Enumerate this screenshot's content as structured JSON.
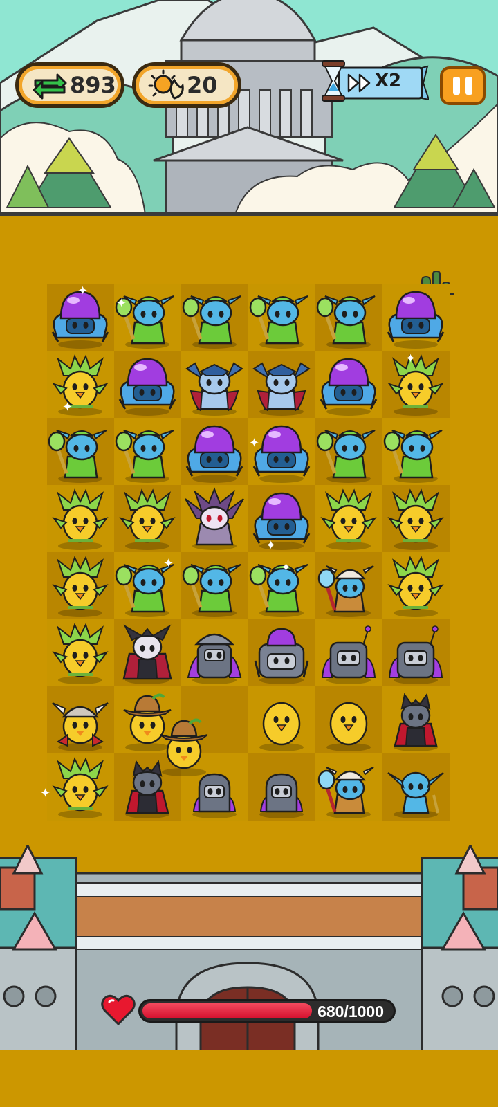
{
  "hud": {
    "swaps_value": "893",
    "swaps_icon": "swap-arrows-icon",
    "energy_value": "20",
    "energy_icon": "sun-moon-icon",
    "speed_label": "X2",
    "speed_icon": "fast-forward-icon",
    "timer_icon": "hourglass-icon",
    "pause_icon": "pause-icon"
  },
  "health": {
    "text": "680/1000",
    "fraction": 0.68,
    "icon": "heart-icon"
  },
  "board": {
    "columns": 6,
    "rows": 8,
    "grid": [
      [
        "purple-dome-crab",
        "green-goblin-mace",
        "green-goblin-mace",
        "green-goblin-mace",
        "green-goblin-mace",
        "purple-dome-crab"
      ],
      [
        "leaf-chick",
        "purple-dome-crab",
        "blue-winged-demon",
        "blue-winged-demon",
        "purple-dome-crab",
        "leaf-chick"
      ],
      [
        "green-goblin-mace",
        "green-goblin-mace",
        "purple-dome-crab",
        "purple-dome-crab",
        "green-goblin-mace",
        "green-goblin-mace"
      ],
      [
        "leaf-chick",
        "leaf-chick",
        "purple-demon-lord",
        "purple-dome-crab",
        "leaf-chick",
        "leaf-chick"
      ],
      [
        "leaf-chick",
        "green-goblin-mace",
        "green-goblin-mace",
        "green-goblin-mace",
        "skull-helmet-goblin",
        "leaf-chick"
      ],
      [
        "leaf-chick",
        "vampire-cape",
        "armored-knight",
        "purple-dome-robot",
        "gray-robot",
        "gray-robot"
      ],
      [
        "viking-chick",
        "cowboy-chick",
        "empty",
        "yellow-chick",
        "yellow-chick",
        "vampire-boy"
      ],
      [
        "leaf-chick",
        "vampire-boy",
        "small-robot",
        "small-robot",
        "skull-helmet-goblin",
        "blue-goblin"
      ]
    ]
  },
  "colors": {
    "field": "#CC9700",
    "sky": "#8FE6D2",
    "hp_fill": "#E01E3A",
    "pause_button": "#F8A020"
  }
}
